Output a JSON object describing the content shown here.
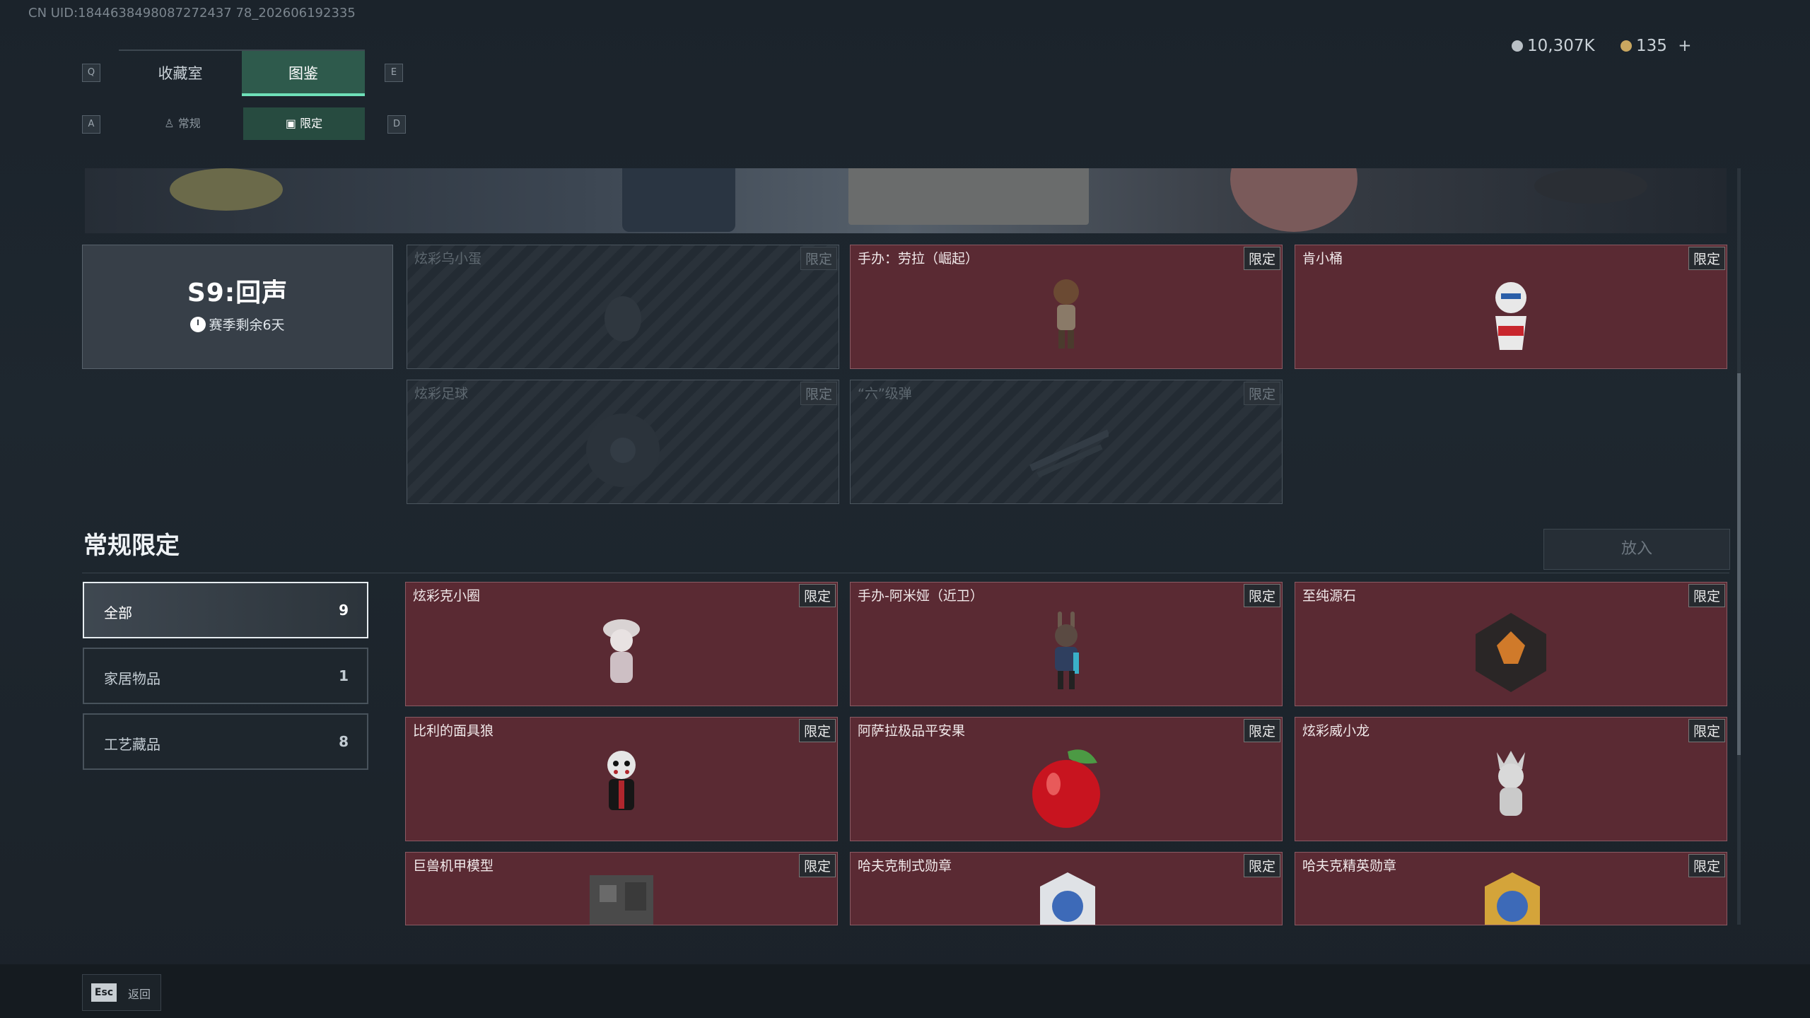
{
  "uid": "CN UID:1844638498087272437 78_202606192335",
  "keys": {
    "q": "Q",
    "e": "E",
    "a": "A",
    "d": "D"
  },
  "tabs": [
    {
      "label": "收藏室"
    },
    {
      "label": "图鉴"
    }
  ],
  "subtabs": [
    {
      "label": "常规"
    },
    {
      "label": "限定"
    }
  ],
  "currency": {
    "silver": "10,307K",
    "gold": "135",
    "plus": "+"
  },
  "season": {
    "title": "S9:回声",
    "remaining": "赛季剩余6天"
  },
  "season_items": [
    {
      "name": "炫彩乌小蛋",
      "tag": "限定",
      "locked": true
    },
    {
      "name": "手办：劳拉（崛起）",
      "tag": "限定",
      "locked": false
    },
    {
      "name": "肯小桶",
      "tag": "限定",
      "locked": false
    },
    {
      "name": "炫彩足球",
      "tag": "限定",
      "locked": true
    },
    {
      "name": "“六”级弹",
      "tag": "限定",
      "locked": true
    }
  ],
  "section": {
    "title": "常规限定",
    "put_button": "放入"
  },
  "categories": [
    {
      "label": "全部",
      "count": "9"
    },
    {
      "label": "家居物品",
      "count": "1"
    },
    {
      "label": "工艺藏品",
      "count": "8"
    }
  ],
  "items": [
    {
      "name": "炫彩克小圈",
      "tag": "限定"
    },
    {
      "name": "手办-阿米娅（近卫）",
      "tag": "限定"
    },
    {
      "name": "至纯源石",
      "tag": "限定"
    },
    {
      "name": "比利的面具狼",
      "tag": "限定"
    },
    {
      "name": "阿萨拉极品平安果",
      "tag": "限定"
    },
    {
      "name": "炫彩威小龙",
      "tag": "限定"
    },
    {
      "name": "巨兽机甲模型",
      "tag": "限定"
    },
    {
      "name": "哈夫克制式勋章",
      "tag": "限定"
    },
    {
      "name": "哈夫克精英勋章",
      "tag": "限定"
    }
  ],
  "footer": {
    "esc_key": "Esc",
    "esc_label": "返回"
  }
}
